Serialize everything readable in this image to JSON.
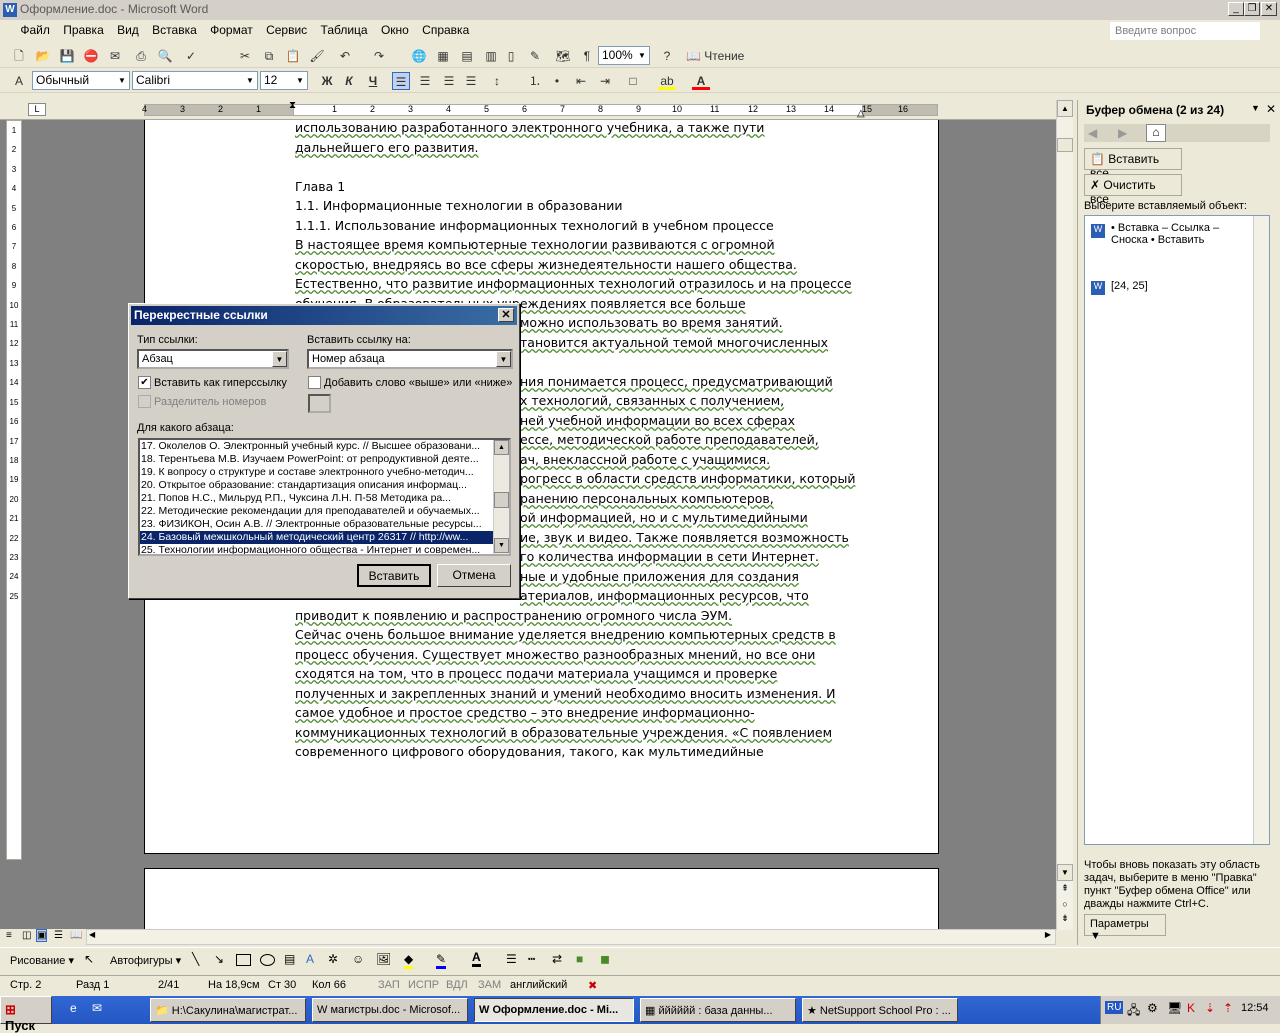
{
  "window": {
    "title": "Оформление.doc - Microsoft Word",
    "app_icon": "W"
  },
  "menubar": {
    "items": [
      "Файл",
      "Правка",
      "Вид",
      "Вставка",
      "Формат",
      "Сервис",
      "Таблица",
      "Окно",
      "Справка"
    ],
    "ask_placeholder": "Введите вопрос"
  },
  "toolbar1": {
    "zoom": "100%",
    "reading_label": "Чтение"
  },
  "toolbar2": {
    "style": "Обычный",
    "font": "Calibri",
    "size": "12",
    "bold": "Ж",
    "italic": "К",
    "underline": "Ч"
  },
  "ruler": {
    "ticks": [
      "4",
      "3",
      "2",
      "1",
      "1",
      "2",
      "3",
      "4",
      "5",
      "6",
      "7",
      "8",
      "9",
      "10",
      "11",
      "12",
      "13",
      "14",
      "15",
      "16"
    ],
    "vticks": [
      "1",
      "2",
      "3",
      "4",
      "5",
      "6",
      "7",
      "8",
      "9",
      "10",
      "11",
      "12",
      "13",
      "14",
      "15",
      "16",
      "17",
      "18",
      "19",
      "20",
      "21",
      "22",
      "23",
      "24",
      "25"
    ]
  },
  "document": {
    "lines": [
      "использованию разработанного электронного учебника, а также пути",
      "дальнейшего его развития.",
      "",
      "Глава 1",
      "1.1. Информационные технологии в образовании",
      "1.1.1. Использование информационных технологий в учебном процессе",
      "В настоящее время компьютерные технологии развиваются с огромной",
      "скоростью, внедряясь во все сферы жизнедеятельности нашего общества.",
      "Естественно, что развитие информационных технологий отразилось и на процессе"
    ],
    "partial_lines": [
      "обучения. В образовательных учреждениях  появляется все больше",
      "можно использовать во время занятий.",
      "тановится актуальной темой многочисленных",
      "",
      "ния понимается процесс, предусматривающий",
      "х технологий, связанных с получением,",
      "ней учебной информации во всех сферах",
      "ессе, методической работе преподавателей,",
      "ач, внеклассной работе с учащимися.",
      "рогресс в области средств информатики, который",
      "ранению персональных компьютеров,",
      "ой информацией, но и с мультимедийными",
      "ие, звук и видео. Также появляется возможность",
      "го количества информации в сети Интернет.",
      "ные и удобные приложения для создания",
      "атериалов, информационных ресурсов, что"
    ],
    "lines_after": [
      "приводит к появлению и распространению огромного числа ЭУМ.",
      "Сейчас очень большое внимание уделяется внедрению компьютерных средств в",
      "процесс обучения. Существует множество разнообразных мнений, но все они",
      "сходятся на том, что в процесс подачи материала учащимся и проверке",
      "полученных и закрепленных знаний и умений необходимо вносить изменения. И",
      "самое удобное и простое средство – это внедрение информационно-",
      "коммуникационных технологий в образовательные учреждения. «С появлением",
      "современного  цифрового  оборудования,  такого,  как  мультимедийные"
    ]
  },
  "dialog": {
    "title": "Перекрестные ссылки",
    "ref_type_label": "Тип ссылки:",
    "ref_type_value": "Абзац",
    "insert_ref_label": "Вставить ссылку на:",
    "insert_ref_value": "Номер абзаца",
    "hyperlink_label": "Вставить как гиперссылку",
    "hyperlink_checked": "✔",
    "above_below_label": "Добавить слово «выше» или «ниже»",
    "separator_label": "Разделитель номеров",
    "for_which_label": "Для какого абзаца:",
    "items": [
      "17. Околелов О. Электронный учебный курс. // Высшее образовани...",
      "18. Терентьева М.В. Изучаем PowerPoint: от репродуктивной деяте...",
      "19. К вопросу о структуре и составе электронного учебно-методич...",
      "20. Открытое  образование:  стандартизация  описания  информац...",
      "21. Попов Н.С.,  Мильруд Р.П.,  Чуксина Л.Н.  П-58     Методика ра...",
      "22. Методические рекомендации для преподавателей и обучаемых...",
      "23. ФИЗИКОН, Осин А.В. // Электронные образовательные ресурсы...",
      "24. Базовый межшкольный методический  центр 26317 // http://ww...",
      "25. Технологии информационного общества - Интернет и современ..."
    ],
    "selected_index": 7,
    "insert_button": "Вставить",
    "cancel_button": "Отмена"
  },
  "taskpane": {
    "title": "Буфер обмена (2 из 24)",
    "paste_all": "Вставить все",
    "clear_all": "Очистить все",
    "choose_label": "Выберите вставляемый объект:",
    "clip1": "• Вставка – Ссылка – Сноска • Вставить",
    "clip2": "[24, 25]",
    "hint": "Чтобы вновь показать эту область задач, выберите в меню \"Правка\" пункт \"Буфер обмена Office\" или дважды нажмите Ctrl+C.",
    "options": "Параметры"
  },
  "drawbar": {
    "drawing": "Рисование",
    "autoshapes": "Автофигуры"
  },
  "status": {
    "page": "Стр. 2",
    "section": "Разд 1",
    "pages": "2/41",
    "at": "На 18,9см",
    "line": "Ст 30",
    "col": "Кол 66",
    "rec": "ЗАП",
    "trk": "ИСПР",
    "ext": "ВДЛ",
    "ovr": "ЗАМ",
    "lang": "английский"
  },
  "taskbar": {
    "start": "Пуск",
    "tasks": [
      "H:\\Сакулина\\магистрат...",
      "магистры.doc - Microsof...",
      "Оформление.doc - Mi...",
      "йййййй : база данны...",
      "NetSupport School Pro : ..."
    ],
    "active_index": 2,
    "lang": "RU",
    "time": "12:54"
  }
}
